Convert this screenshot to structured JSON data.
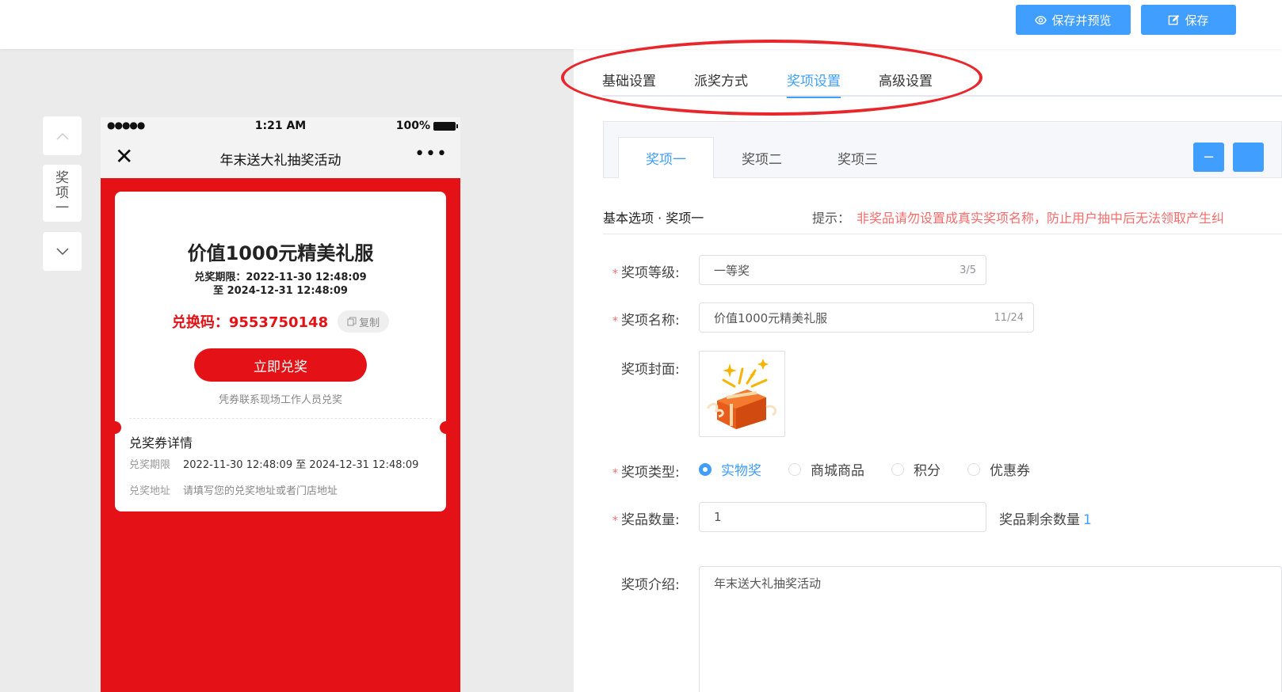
{
  "toolbar": {
    "preview_label": "保存并预览",
    "save_label": "保存",
    "preview_icon": "eye-icon",
    "save_icon": "edit-icon"
  },
  "side_nav": {
    "label_chars": [
      "奖",
      "项",
      "一"
    ],
    "up_icon": "chevron-up-icon",
    "down_icon": "chevron-down-icon"
  },
  "phone": {
    "status": {
      "dots": "●●●●●",
      "time": "1:21 AM",
      "battery": "100%"
    },
    "nav": {
      "close": "✕",
      "title": "年末送大礼抽奖活动",
      "more": "•••"
    },
    "card": {
      "prize_name": "价值1000元精美礼服",
      "period_line1": "兑奖期限：2022-11-30 12:48:09",
      "period_line2": "至 2024-12-31 12:48:09",
      "code": "兑换码：9553750148",
      "copy_label": "复制",
      "redeem_label": "立即兑奖",
      "redeem_note": "凭券联系现场工作人员兑奖",
      "detail_title": "兑奖券详情",
      "details": [
        {
          "key": "兑奖期限",
          "value": "2022-11-30 12:48:09 至 2024-12-31 12:48:09"
        },
        {
          "key": "兑奖地址",
          "value": "请填写您的兑奖地址或者门店地址"
        }
      ]
    }
  },
  "main_tabs": [
    "基础设置",
    "派奖方式",
    "奖项设置",
    "高级设置"
  ],
  "active_main_tab": "奖项设置",
  "sub_tabs": [
    "奖项一",
    "奖项二",
    "奖项三"
  ],
  "active_sub_tab": "奖项一",
  "sub_tab_buttons": [
    "−"
  ],
  "section": {
    "title": "基本选项 · 奖项一",
    "tip_label": "提示：",
    "tip_text": "非奖品请勿设置成真实奖项名称，防止用户抽中后无法领取产生纠"
  },
  "form": {
    "level": {
      "label": "奖项等级:",
      "value": "一等奖",
      "count": "3/5"
    },
    "name": {
      "label": "奖项名称:",
      "value": "价值1000元精美礼服",
      "count": "11/24"
    },
    "cover": {
      "label": "奖项封面:"
    },
    "type": {
      "label": "奖项类型:",
      "options": [
        "实物奖",
        "商城商品",
        "积分",
        "优惠券"
      ],
      "selected": "实物奖"
    },
    "quantity": {
      "label": "奖品数量:",
      "value": "1",
      "remain_label": "奖品剩余数量",
      "remain_value": "1"
    },
    "intro": {
      "label": "奖项介绍:",
      "value": "年末送大礼抽奖活动"
    }
  },
  "colors": {
    "accent": "#409eff",
    "brand_red": "#e41216",
    "annotation_red": "#e8262b",
    "tip_red": "#f56c6c"
  }
}
